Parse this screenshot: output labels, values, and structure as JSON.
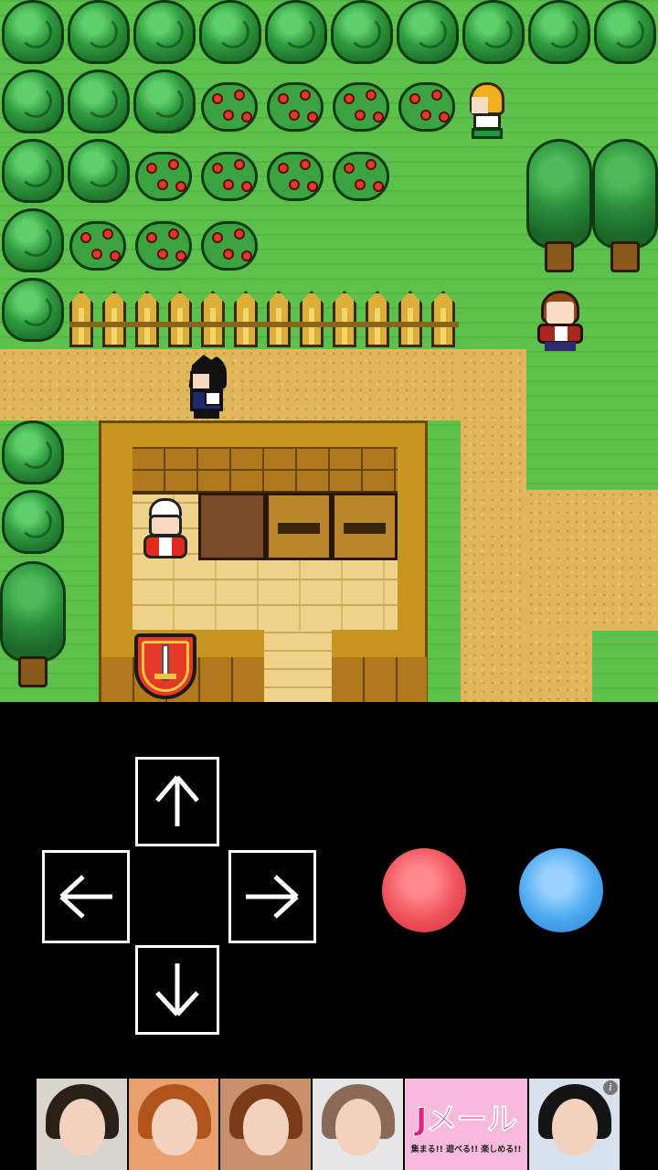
{
  "controls": {
    "up_icon": "arrow-up-icon",
    "down_icon": "arrow-down-icon",
    "left_icon": "arrow-left-icon",
    "right_icon": "arrow-right-icon",
    "a_button_color": "#f0525a",
    "b_button_color": "#4ba9ef"
  },
  "ad": {
    "logo_text": "Jメール",
    "tagline": "集まる!! 遊べる!! 楽しめる!!",
    "info_label": "i"
  },
  "colors": {
    "grass": "#5cc24c",
    "path": "#e0b75a",
    "wall": "#c8961e",
    "background": "#000000"
  }
}
